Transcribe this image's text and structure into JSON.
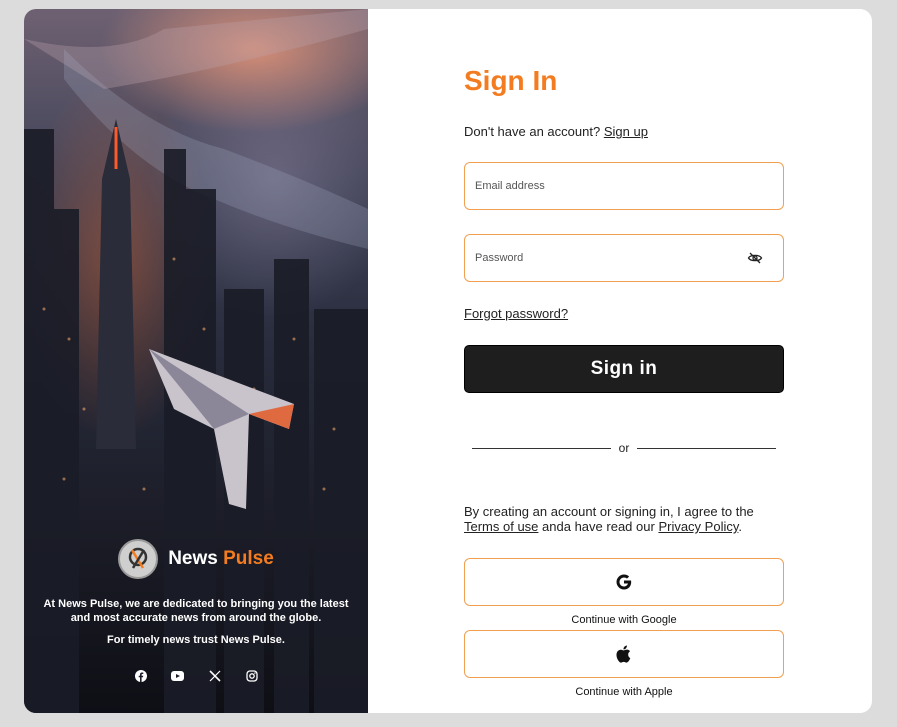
{
  "brand": {
    "name_part1": "News",
    "name_part2": "Pulse",
    "accent": "#f47c20"
  },
  "left_panel": {
    "description": "At News Pulse, we are dedicated to bringing you the latest and most accurate news from around the globe.",
    "tagline": "For timely news trust News Pulse.",
    "socials": [
      "facebook-icon",
      "youtube-icon",
      "x-icon",
      "instagram-icon"
    ]
  },
  "form": {
    "title": "Sign In",
    "no_account_text": "Don't have an account?",
    "sign_up_link": "Sign up",
    "email_placeholder": "Email address",
    "password_placeholder": "Password",
    "forgot_password": "Forgot password?",
    "sign_in_button": "Sign in",
    "divider_text": "or",
    "agree_text_1": "By creating an account or signing in, I agree to the",
    "terms_link": "Terms of use",
    "agree_text_2": "anda have read our",
    "privacy_link": "Privacy Policy",
    "agree_text_3": ".",
    "google_label": "Continue with Google",
    "apple_label": "Continue with Apple"
  },
  "colors": {
    "accent": "#f47c20",
    "button_bg": "#1e1e1e",
    "field_border": "#f0a050"
  }
}
